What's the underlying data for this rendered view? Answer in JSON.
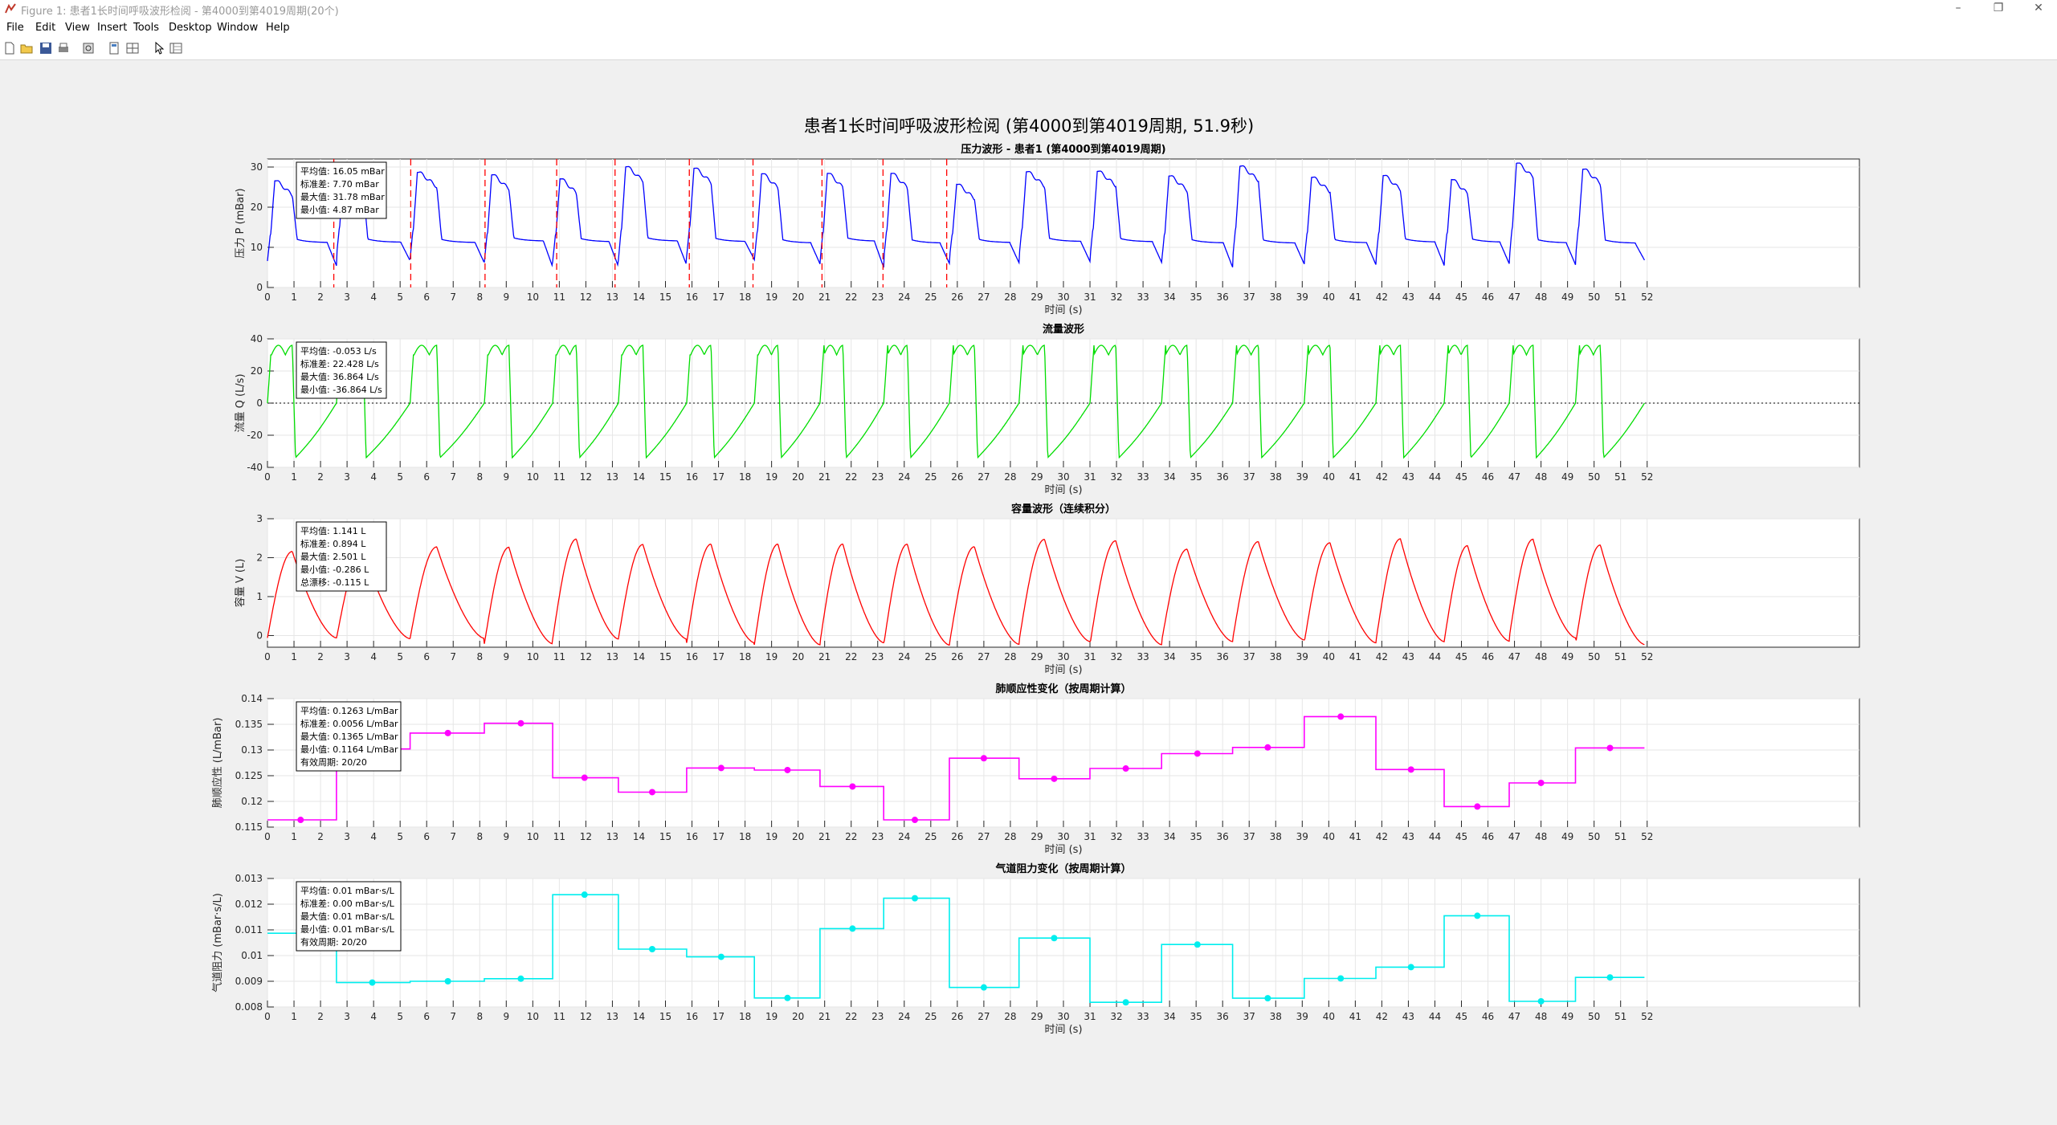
{
  "window": {
    "title": "Figure 1: 患者1长时间呼吸波形检阅 - 第4000到第4019周期(20个)",
    "controls": [
      "–",
      "❐",
      "✕"
    ]
  },
  "menu": [
    "File",
    "Edit",
    "View",
    "Insert",
    "Tools",
    "Desktop",
    "Window",
    "Help"
  ],
  "toolbar": [
    "new-figure-icon",
    "open-file-icon",
    "save-icon",
    "print-icon",
    "print-preview-icon",
    "hide-plot-tools-icon",
    "show-plot-tools-icon",
    "edit-plot-arrow-icon",
    "property-editor-icon"
  ],
  "colors": {
    "pressure": "#0000ff",
    "flow": "#00dd00",
    "volume": "#ff0000",
    "compliance": "#ff00ff",
    "resistance": "#00eeee",
    "marker": "#ff0000"
  },
  "figure": {
    "super_title": "患者1长时间呼吸波形检阅 (第4000到第4019周期, 51.9秒)",
    "x_label": "时间 (s)",
    "x_ticks": [
      0,
      1,
      2,
      3,
      4,
      5,
      6,
      7,
      8,
      9,
      10,
      11,
      12,
      13,
      14,
      15,
      16,
      17,
      18,
      19,
      20,
      21,
      22,
      23,
      24,
      25,
      26,
      27,
      28,
      29,
      30,
      31,
      32,
      33,
      34,
      35,
      36,
      37,
      38,
      39,
      40,
      41,
      42,
      43,
      44,
      45,
      46,
      47,
      48,
      49,
      50,
      51,
      52
    ],
    "x_range": [
      0,
      60
    ]
  },
  "chart_data": [
    {
      "type": "line",
      "title": "压力波形 - 患者1 (第4000到第4019周期)",
      "ylabel": "压力 P (mBar)",
      "ylim": [
        0,
        32
      ],
      "yticks": [
        0,
        10,
        20,
        30
      ],
      "series": [
        {
          "kind": "pressure",
          "values": []
        }
      ],
      "cycle_markers_x": [
        2.5,
        5.4,
        8.2,
        10.9,
        13.1,
        15.9,
        18.3,
        20.9,
        23.2,
        25.6
      ],
      "stats": [
        "平均值: 16.05 mBar",
        "标准差: 7.70 mBar",
        "最大值: 31.78 mBar",
        "最小值: 4.87 mBar"
      ]
    },
    {
      "type": "line",
      "title": "流量波形",
      "ylabel": "流量 Q (L/s)",
      "ylim": [
        -40,
        40
      ],
      "yticks": [
        -40,
        -20,
        0,
        20,
        40
      ],
      "zero_line": true,
      "series": [
        {
          "kind": "flow",
          "values": []
        }
      ],
      "stats": [
        "平均值: -0.053 L/s",
        "标准差: 22.428 L/s",
        "最大值: 36.864 L/s",
        "最小值: -36.864 L/s"
      ]
    },
    {
      "type": "line",
      "title": "容量波形（连续积分）",
      "ylabel": "容量 V (L)",
      "ylim": [
        -0.3,
        3
      ],
      "yticks": [
        0,
        1,
        2,
        3
      ],
      "series": [
        {
          "kind": "volume",
          "values": []
        }
      ],
      "stats": [
        "平均值: 1.141 L",
        "标准差: 0.894 L",
        "最大值: 2.501 L",
        "最小值: -0.286 L",
        "总漂移: -0.115 L"
      ]
    },
    {
      "type": "line",
      "title": "肺顺应性变化（按周期计算）",
      "ylabel": "肺顺应性 (L/mBar)",
      "ylim": [
        0.115,
        0.14
      ],
      "yticks": [
        0.115,
        0.12,
        0.125,
        0.13,
        0.135,
        0.14
      ],
      "step": true,
      "series": [
        {
          "kind": "compliance",
          "points": [
            [
              1.25,
              0.1164
            ],
            [
              3.95,
              0.1302
            ],
            [
              6.8,
              0.1333
            ],
            [
              9.55,
              0.1352
            ],
            [
              11.95,
              0.1246
            ],
            [
              14.5,
              0.1218
            ],
            [
              17.1,
              0.1265
            ],
            [
              19.6,
              0.1261
            ],
            [
              22.05,
              0.1229
            ],
            [
              24.4,
              0.1164
            ],
            [
              27.0,
              0.1284
            ],
            [
              29.65,
              0.1244
            ],
            [
              32.35,
              0.1264
            ],
            [
              35.05,
              0.1293
            ],
            [
              37.7,
              0.1305
            ],
            [
              40.45,
              0.1365
            ],
            [
              43.1,
              0.1262
            ],
            [
              45.6,
              0.119
            ],
            [
              48.0,
              0.1236
            ],
            [
              50.6,
              0.1304
            ]
          ]
        }
      ],
      "stats": [
        "平均值: 0.1263 L/mBar",
        "标准差: 0.0056 L/mBar",
        "最大值: 0.1365 L/mBar",
        "最小值: 0.1164 L/mBar",
        "有效周期: 20/20"
      ]
    },
    {
      "type": "line",
      "title": "气道阻力变化（按周期计算）",
      "ylabel": "气道阻力 (mBar·s/L)",
      "ylim": [
        0.008,
        0.013
      ],
      "yticks": [
        0.008,
        0.009,
        0.01,
        0.011,
        0.012,
        0.013
      ],
      "step": true,
      "series": [
        {
          "kind": "resistance",
          "points": [
            [
              1.25,
              0.01087
            ],
            [
              3.95,
              0.00895
            ],
            [
              6.8,
              0.009
            ],
            [
              9.55,
              0.0091
            ],
            [
              11.95,
              0.01237
            ],
            [
              14.5,
              0.01025
            ],
            [
              17.1,
              0.00995
            ],
            [
              19.6,
              0.00835
            ],
            [
              22.05,
              0.01105
            ],
            [
              24.4,
              0.01223
            ],
            [
              27.0,
              0.00876
            ],
            [
              29.65,
              0.01068
            ],
            [
              32.35,
              0.00818
            ],
            [
              35.05,
              0.01043
            ],
            [
              37.7,
              0.00834
            ],
            [
              40.45,
              0.00911
            ],
            [
              43.1,
              0.00955
            ],
            [
              45.6,
              0.01155
            ],
            [
              48.0,
              0.00822
            ],
            [
              50.6,
              0.00915
            ]
          ]
        }
      ],
      "stats": [
        "平均值: 0.01 mBar·s/L",
        "标准差: 0.00 mBar·s/L",
        "最大值: 0.01 mBar·s/L",
        "最小值: 0.01 mBar·s/L",
        "有效周期: 20/20"
      ]
    }
  ]
}
